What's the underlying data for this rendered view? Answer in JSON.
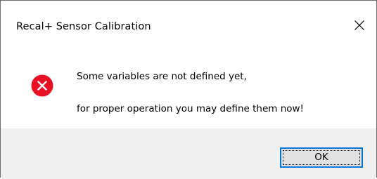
{
  "window": {
    "title": "Recal+ Sensor Calibration",
    "close_icon": "close-icon"
  },
  "message": {
    "icon": "error-icon",
    "icon_color": "#e81123",
    "line1": "Some variables are not defined yet,",
    "line2": "for proper operation you may define them now!"
  },
  "buttons": {
    "ok_label": "OK",
    "accent": "#0078d7"
  }
}
